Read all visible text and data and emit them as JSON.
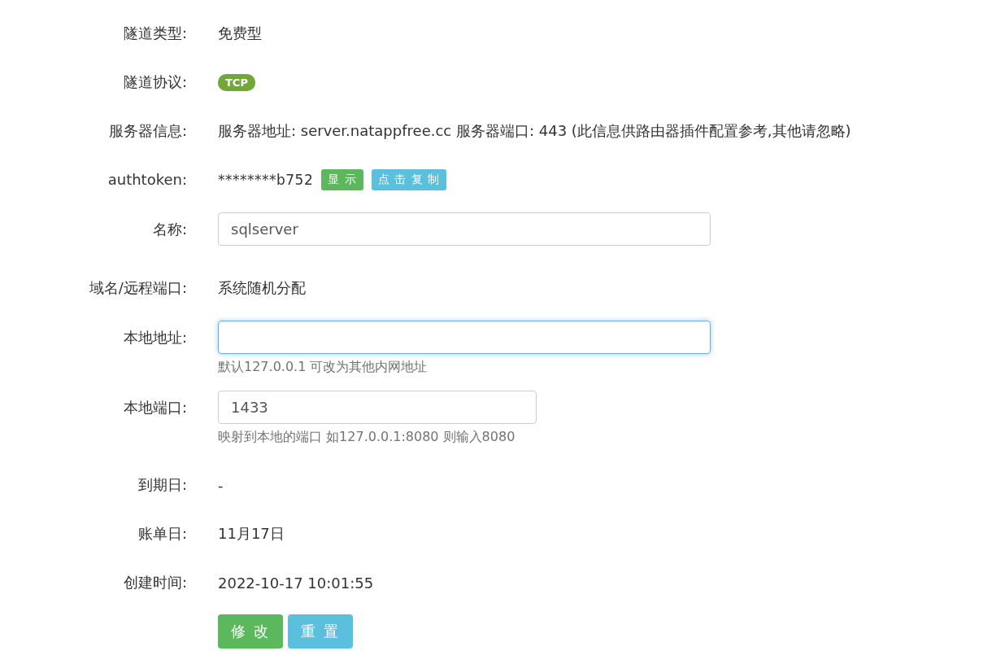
{
  "rows": [
    {
      "kind": "text",
      "label": "隧道类型:",
      "value": "免费型"
    },
    {
      "kind": "badge",
      "label": "隧道协议:",
      "badge": "TCP"
    },
    {
      "kind": "text",
      "label": "服务器信息:",
      "value": "服务器地址: server.natappfree.cc 服务器端口: 443 (此信息供路由器插件配置参考,其他请忽略)"
    },
    {
      "kind": "token",
      "label": "authtoken:",
      "value": "********b752",
      "buttons": [
        {
          "label": "显 示",
          "kind": "primary"
        },
        {
          "label": "点 击 复 制",
          "kind": "secondary"
        }
      ]
    },
    {
      "kind": "input",
      "label": "名称:",
      "value": "sqlserver",
      "focused": false
    },
    {
      "kind": "text",
      "label": "域名/远程端口:",
      "value": "系统随机分配"
    },
    {
      "kind": "input",
      "label": "本地地址:",
      "value": "",
      "focused": true,
      "hint": "默认127.0.0.1 可改为其他内网地址"
    },
    {
      "kind": "narrow-input",
      "label": "本地端口:",
      "value": "1433",
      "focused": false,
      "hint": "映射到本地的端口 如127.0.0.1:8080 则输入8080"
    },
    {
      "kind": "text",
      "label": "到期日:",
      "value": "-"
    },
    {
      "kind": "text",
      "label": "账单日:",
      "value": "11月17日"
    },
    {
      "kind": "text",
      "label": "创建时间:",
      "value": "2022-10-17 10:01:55"
    }
  ],
  "actions": [
    {
      "label": "修 改",
      "kind": "primary"
    },
    {
      "label": "重 置",
      "kind": "secondary"
    }
  ]
}
